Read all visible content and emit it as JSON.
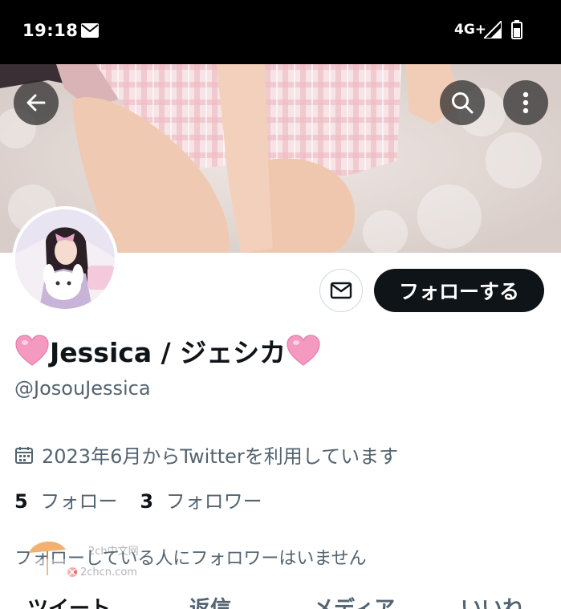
{
  "status_bar": {
    "time": "19:18",
    "network": "4G+",
    "icons": [
      "mail-icon",
      "signal-icon",
      "battery-icon"
    ]
  },
  "header": {
    "icons": [
      "back-arrow-icon",
      "search-icon",
      "more-vertical-icon"
    ]
  },
  "profile": {
    "display_name": "Jessica / ジェシカ",
    "handle": "@JosouJessica",
    "joined": "2023年6月からTwitterを利用しています",
    "following_count": "5",
    "following_label": "フォロー",
    "followers_count": "3",
    "followers_label": "フォロワー",
    "follow_notice": "フォローしている人にフォロワーはいません"
  },
  "actions": {
    "follow_label": "フォローする"
  },
  "tabs": [
    "ツイート",
    "返信",
    "メディア",
    "いいね"
  ],
  "watermark": {
    "line1": "2ch中文网",
    "line2": "2chcn.com"
  },
  "colors": {
    "primary_text": "#0f1419",
    "secondary_text": "#536471",
    "follow_button_bg": "#0f1419",
    "heart_pink": "#f49ac1"
  }
}
